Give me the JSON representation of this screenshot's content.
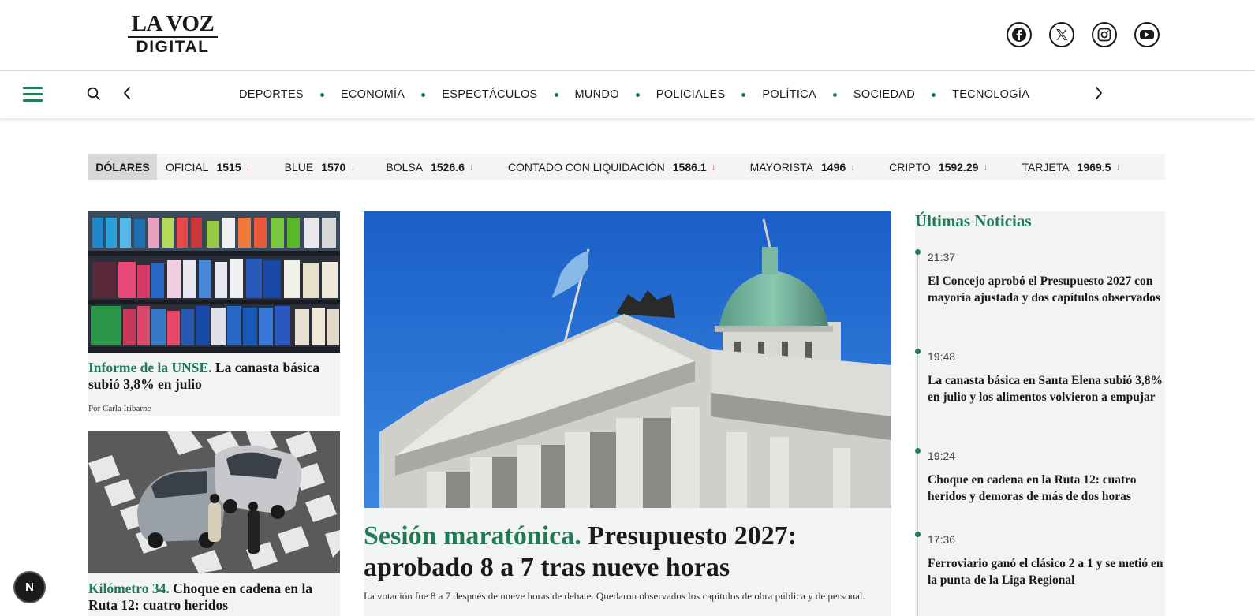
{
  "header": {
    "logo_line1": "LA VOZ",
    "logo_line2": "DIGITAL",
    "socials": [
      "facebook-icon",
      "x-icon",
      "instagram-icon",
      "youtube-icon"
    ]
  },
  "nav": {
    "items": [
      "DEPORTES",
      "ECONOMÍA",
      "ESPECTÁCULOS",
      "MUNDO",
      "POLICIALES",
      "POLÍTICA",
      "SOCIEDAD",
      "TECNOLOGÍA"
    ]
  },
  "ticker": {
    "label": "DÓLARES",
    "rates": [
      {
        "name": "OFICIAL",
        "value": "1515",
        "arrow": "↓"
      },
      {
        "name": "BLUE",
        "value": "1570",
        "arrow": "↓"
      },
      {
        "name": "BOLSA",
        "value": "1526.6",
        "arrow": "↓"
      },
      {
        "name": "CONTADO CON LIQUIDACIÓN",
        "value": "1586.1",
        "arrow": "↓"
      },
      {
        "name": "MAYORISTA",
        "value": "1496",
        "arrow": "↓"
      },
      {
        "name": "CRIPTO",
        "value": "1592.29",
        "arrow": "↓"
      },
      {
        "name": "TARJETA",
        "value": "1969.5",
        "arrow": "↓"
      }
    ]
  },
  "left_cards": [
    {
      "kicker": "Informe de la UNSE.",
      "title": " La canasta básica subió 3,8% en julio",
      "author": "Por Carla Iribarne"
    },
    {
      "kicker": "Kilómetro 34.",
      "title": " Choque en cadena en la Ruta 12: cuatro heridos"
    }
  ],
  "main_story": {
    "kicker": "Sesión maratónica.",
    "title": " Presupuesto 2027: aprobado 8 a 7 tras nueve horas",
    "subtitle": "La votación fue 8 a 7 después de nueve horas de debate. Quedaron observados los capítulos de obra pública y de personal."
  },
  "latest": {
    "title": "Últimas Noticias",
    "items": [
      {
        "time": "21:37",
        "headline": "El Concejo aprobó el Presupuesto 2027 con mayoría ajustada y dos capítulos observados"
      },
      {
        "time": "19:48",
        "headline": "La canasta básica en Santa Elena subió 3,8% en julio y los alimentos volvieron a empujar"
      },
      {
        "time": "19:24",
        "headline": "Choque en cadena en la Ruta 12: cuatro heridos y demoras de más de dos horas"
      },
      {
        "time": "17:36",
        "headline": "Ferroviario ganó el clásico 2 a 1 y se metió en la punta de la Liga Regional"
      }
    ]
  },
  "badge": "N",
  "colors": {
    "accent": "#1f7a55",
    "down_arrow": "#d64545"
  }
}
